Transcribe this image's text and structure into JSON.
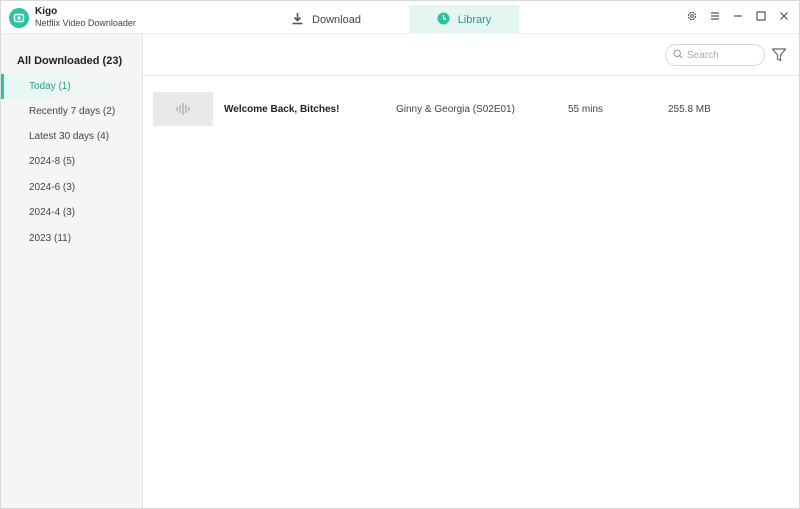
{
  "app": {
    "name": "Kigo",
    "subtitle": "Netflix Video Downloader"
  },
  "nav": {
    "download_label": "Download",
    "library_label": "Library",
    "active": "library"
  },
  "colors": {
    "accent": "#2ec4a3",
    "accent_text": "#2a9d88",
    "active_tab_bg": "#e3f6f2"
  },
  "sidebar": {
    "header": "All Downloaded (23)",
    "items": [
      {
        "label": "Today (1)",
        "active": true
      },
      {
        "label": "Recently 7 days (2)",
        "active": false
      },
      {
        "label": "Latest 30 days (4)",
        "active": false
      },
      {
        "label": "2024-8 (5)",
        "active": false
      },
      {
        "label": "2024-6 (3)",
        "active": false
      },
      {
        "label": "2024-4 (3)",
        "active": false
      },
      {
        "label": "2023 (11)",
        "active": false
      }
    ]
  },
  "search": {
    "placeholder": "Search",
    "value": ""
  },
  "icons": {
    "download": "download-icon",
    "library": "clock-icon",
    "settings": "gear-icon",
    "menu": "menu-icon",
    "minimize": "minimize-icon",
    "maximize": "maximize-icon",
    "close": "close-icon",
    "search": "search-icon",
    "filter": "filter-icon",
    "thumbnail": "audio-wave-icon"
  },
  "library": {
    "rows": [
      {
        "title": "Welcome Back, Bitches!",
        "series": "Ginny & Georgia (S02E01)",
        "duration": "55 mins",
        "size": "255.8 MB"
      }
    ]
  }
}
